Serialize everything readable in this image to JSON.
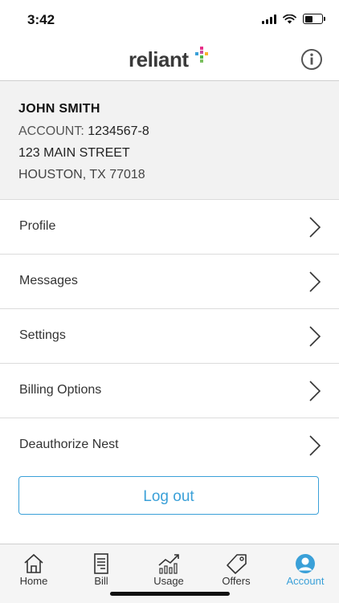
{
  "status_bar": {
    "time": "3:42"
  },
  "header": {
    "logo_text": "reliant",
    "logo_mark_colors": [
      "#e8308a",
      "#f7b52c",
      "#3aa0d8",
      "#4db848"
    ]
  },
  "account": {
    "name": "JOHN SMITH",
    "account_label": "ACCOUNT:",
    "account_number": "1234567-8",
    "street": "123 MAIN STREET",
    "city_line": "HOUSTON, TX 77018"
  },
  "menu": {
    "items": [
      {
        "label": "Profile"
      },
      {
        "label": "Messages"
      },
      {
        "label": "Settings"
      },
      {
        "label": "Billing Options"
      },
      {
        "label": "Deauthorize Nest"
      }
    ]
  },
  "logout": {
    "label": "Log out"
  },
  "tabs": [
    {
      "label": "Home",
      "icon": "home-icon"
    },
    {
      "label": "Bill",
      "icon": "bill-icon"
    },
    {
      "label": "Usage",
      "icon": "usage-icon"
    },
    {
      "label": "Offers",
      "icon": "offers-icon"
    },
    {
      "label": "Account",
      "icon": "account-icon",
      "active": true
    }
  ],
  "colors": {
    "accent": "#3aa0d8",
    "header_border": "#cfcfcf",
    "info_bg": "#f2f2f2"
  }
}
